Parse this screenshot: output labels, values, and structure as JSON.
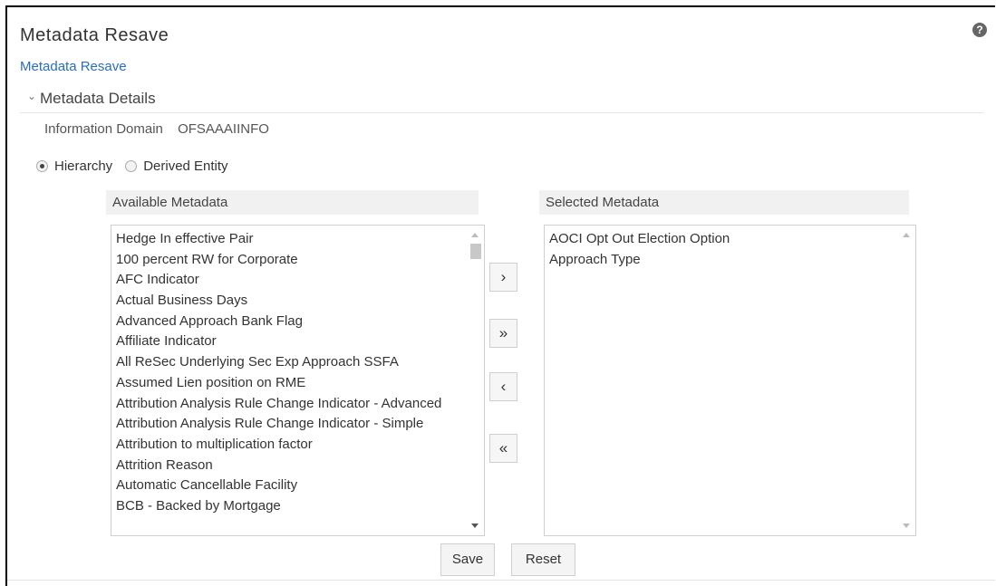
{
  "page": {
    "title": "Metadata Resave",
    "breadcrumb": "Metadata Resave",
    "help_icon_glyph": "?"
  },
  "section": {
    "title": "Metadata Details",
    "chevron": "⌄"
  },
  "info_domain": {
    "label": "Information Domain",
    "value": "OFSAAAIINFO"
  },
  "radio": {
    "options": [
      {
        "label": "Hierarchy",
        "selected": true
      },
      {
        "label": "Derived Entity",
        "selected": false
      }
    ]
  },
  "available": {
    "header": "Available Metadata",
    "items": [
      "Hedge In effective Pair",
      "100 percent RW for Corporate",
      "AFC Indicator",
      "Actual Business Days",
      "Advanced Approach Bank Flag",
      "Affiliate Indicator",
      "All ReSec Underlying Sec Exp Approach SSFA",
      "Assumed Lien position on RME",
      "Attribution Analysis Rule Change Indicator - Advanced",
      "Attribution Analysis Rule Change Indicator - Simple",
      "Attribution to multiplication factor",
      "Attrition Reason",
      "Automatic Cancellable Facility",
      "BCB - Backed by Mortgage"
    ]
  },
  "selected": {
    "header": "Selected Metadata",
    "items": [
      "AOCI Opt Out Election Option",
      "Approach Type"
    ]
  },
  "move_buttons": {
    "move_right": "›",
    "move_all_right": "»",
    "move_left": "‹",
    "move_all_left": "«"
  },
  "actions": {
    "save": "Save",
    "reset": "Reset"
  },
  "colors": {
    "link": "#2a6ebb",
    "header_bg": "#f1f1f1"
  }
}
